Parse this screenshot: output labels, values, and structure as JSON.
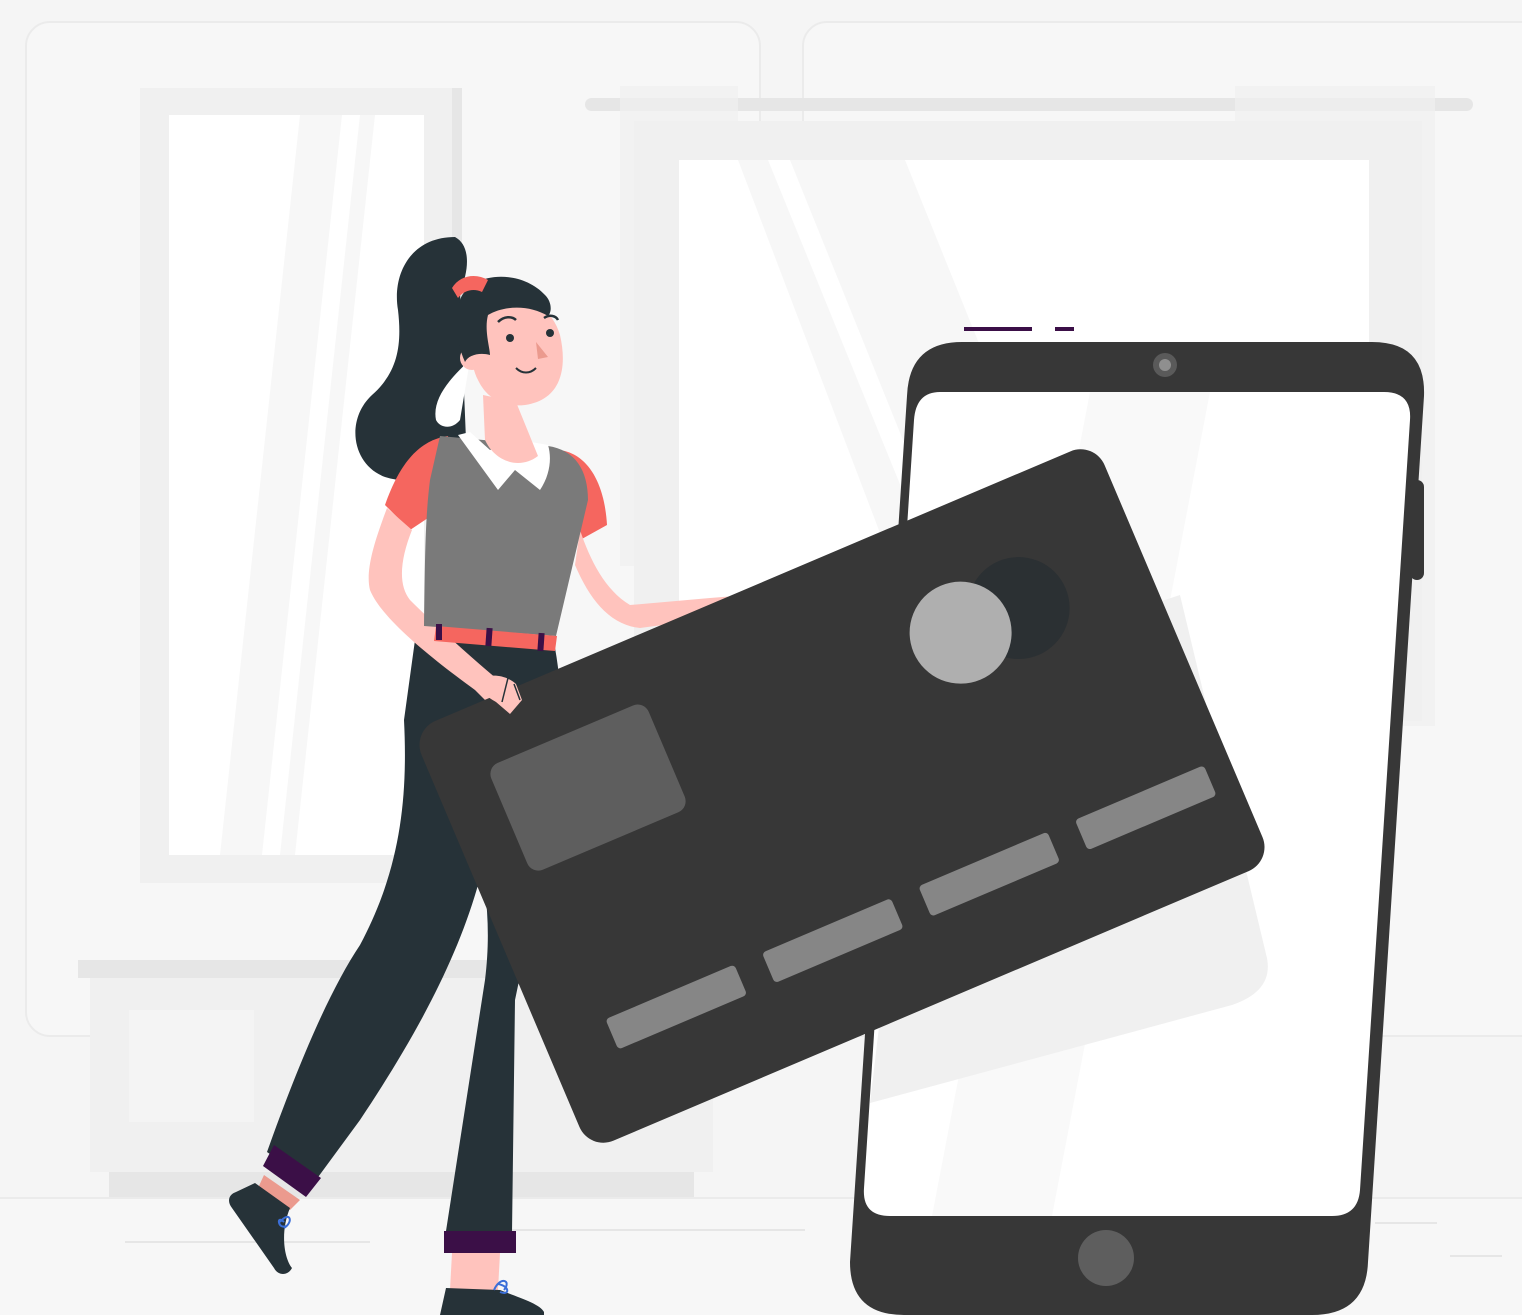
{
  "colors": {
    "background": "#f5f5f5",
    "panel": "#f7f7f7",
    "panel_border": "#ebebeb",
    "window_glass": "#ffffff",
    "window_frame": "#f0f0f0",
    "window_frame_dark": "#e6e6e6",
    "device_body": "#373737",
    "device_screen": "#ffffff",
    "device_camera": "#5a5a5a",
    "device_button": "#5e5e5e",
    "card_body": "#373737",
    "card_chip": "#5e5e5e",
    "card_number_block": "#868686",
    "card_logo_light": "#afafaf",
    "card_logo_dark": "#2b3033",
    "hair": "#263238",
    "skin": "#ffc3bd",
    "skin_shadow": "#eb9a8e",
    "sleeve": "#f5665f",
    "vest": "#7a7a7a",
    "collar": "#ffffff",
    "trousers": "#263238",
    "cuff": "#3b0f47",
    "belt": "#f5665f",
    "shoe": "#263238",
    "lace": "#3b6fd8",
    "accent": "#3b0f47"
  },
  "icons": [
    "credit-card-icon",
    "smartphone-icon",
    "person-illustration",
    "window-illustration",
    "card-chip-icon",
    "card-logo-icon"
  ]
}
